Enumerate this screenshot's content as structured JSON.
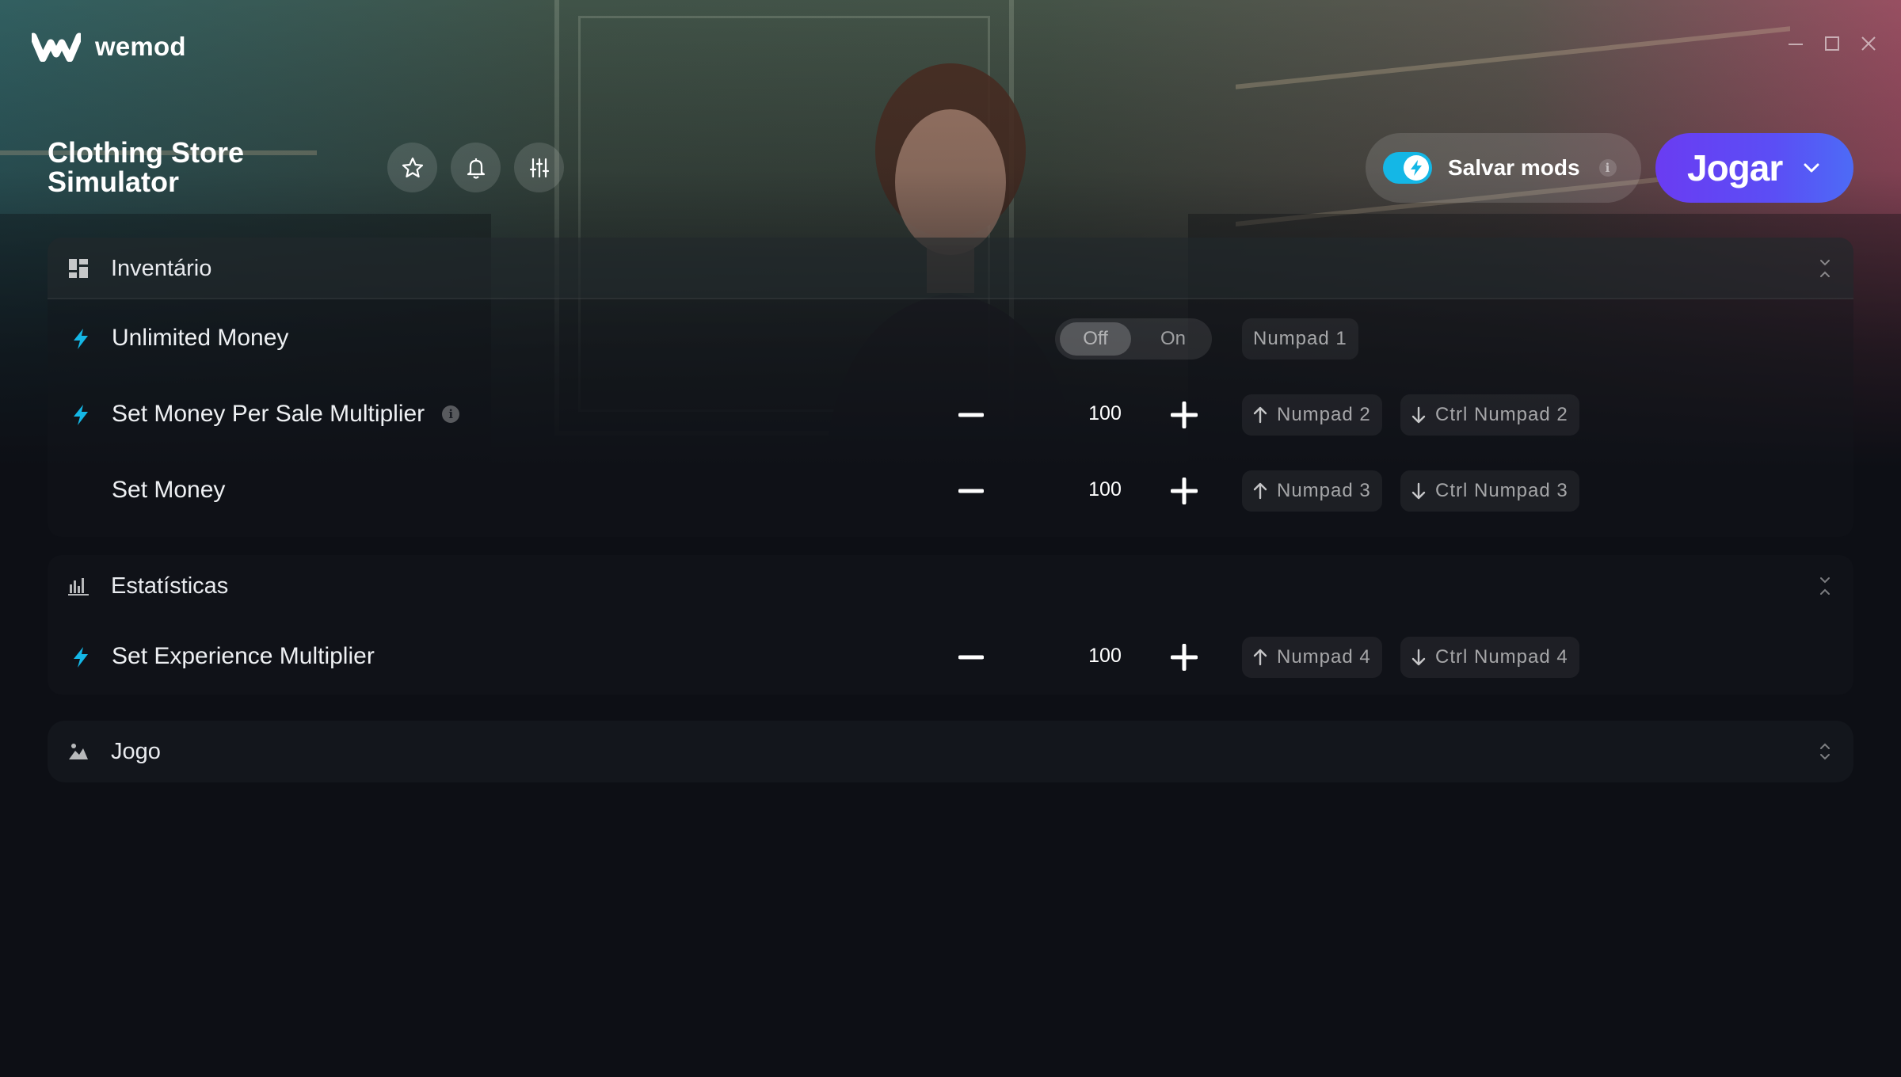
{
  "app": {
    "name": "wemod",
    "window_controls": [
      "minimize",
      "maximize",
      "close"
    ]
  },
  "game": {
    "title": "Clothing Store Simulator",
    "action_icons": [
      "star-icon",
      "bell-icon",
      "sliders-icon"
    ]
  },
  "save_mods": {
    "label": "Salvar mods",
    "enabled": true,
    "info": "i"
  },
  "play": {
    "label": "Jogar"
  },
  "sections": {
    "inventory": {
      "title": "Inventário",
      "rows": [
        {
          "label": "Unlimited Money",
          "type": "toggle",
          "state": "Off",
          "off_label": "Off",
          "on_label": "On",
          "hotkey": "Numpad 1"
        },
        {
          "label": "Set Money Per Sale Multiplier",
          "type": "stepper",
          "value": "100",
          "hotkey_up": "Numpad 2",
          "hotkey_down": "Ctrl Numpad 2",
          "has_info": true
        },
        {
          "label": "Set Money",
          "type": "stepper",
          "value": "100",
          "hotkey_up": "Numpad 3",
          "hotkey_down": "Ctrl Numpad 3"
        }
      ]
    },
    "stats": {
      "title": "Estatísticas",
      "rows": [
        {
          "label": "Set Experience Multiplier",
          "type": "stepper",
          "value": "100",
          "hotkey_up": "Numpad 4",
          "hotkey_down": "Ctrl Numpad 4"
        }
      ]
    },
    "game": {
      "title": "Jogo"
    }
  },
  "colors": {
    "accent": "#14b7e6",
    "play_gradient_start": "#6a3cf2",
    "play_gradient_end": "#4d6bf6",
    "background": "#0d0f15"
  }
}
